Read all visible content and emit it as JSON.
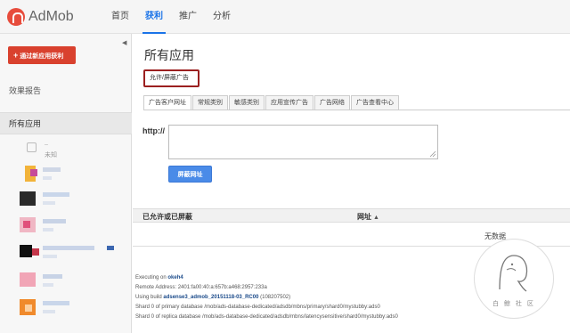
{
  "app": {
    "name": "AdMob"
  },
  "nav": [
    {
      "label": "首页",
      "active": false
    },
    {
      "label": "获利",
      "active": true
    },
    {
      "label": "推广",
      "active": false
    },
    {
      "label": "分析",
      "active": false
    }
  ],
  "sidebar": {
    "create_label": "通过新应用获利",
    "report_label": "效果报告",
    "all_apps_label": "所有应用",
    "first_app": {
      "name": "..",
      "status": "未知"
    }
  },
  "main": {
    "title": "所有应用",
    "filter_label": "允许/屏蔽广告",
    "tabs": [
      "广告客户网址",
      "常规类别",
      "敏感类别",
      "应用宣传广告",
      "广告网络",
      "广告查看中心"
    ],
    "http_label": "http://",
    "url_value": "",
    "block_button": "屏蔽网址",
    "table": {
      "col1": "已允许或已屏蔽",
      "col2": "网址",
      "empty": "无数据"
    }
  },
  "footer": {
    "executing_prefix": "Executing on ",
    "executing_host": "okeh4",
    "remote_address": "Remote Address: 2401:fa00:40:a:657b:a468:2957:233a",
    "build_prefix": "Using build ",
    "build_name": "adsense3_admob_20151118-03_RC00",
    "build_suffix": " (108207502)",
    "shard_primary": "Shard 0 of primary database /mob/ads-database-dedicated/adsdb/mbns/primary/shard0/mystubby:ads0",
    "shard_replica": "Shard 0 of replica database /mob/ads-database-dedicated/adsdb/mbns/latencysensitive/shard0/mystubby:ads0"
  },
  "watermark": {
    "text": "白 鲸 社 区"
  },
  "colors": {
    "accent": "#1a73e8",
    "create_button": "#d9412e",
    "block_button": "#4a8be8",
    "highlight_box": "#9b1f1f"
  }
}
